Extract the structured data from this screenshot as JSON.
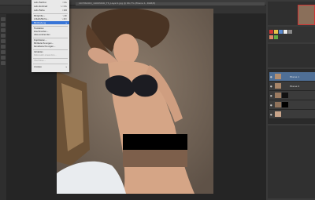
{
  "document": {
    "tab_title": "1070SOOO_14093400_TS_Layer1.jpg @ 66,7% (Ebene 1, RGB/8)"
  },
  "menu": {
    "items": [
      {
        "label": "Auto-Farbton",
        "shortcut": "⇧⌘L"
      },
      {
        "label": "Auto-Kontrast",
        "shortcut": "⌥⇧⌘L"
      },
      {
        "label": "Auto-Farbe",
        "shortcut": "⇧⌘B"
      },
      {
        "label": "Bildgröße...",
        "shortcut": "⌥⌘I"
      },
      {
        "label": "Arbeitsfläche...",
        "shortcut": "⌥⌘C"
      },
      {
        "label": "Bilddrehung",
        "shortcut": ""
      },
      {
        "label": "Freistellen",
        "shortcut": ""
      },
      {
        "label": "Zuschneiden...",
        "shortcut": ""
      },
      {
        "label": "Alles einblenden",
        "shortcut": ""
      },
      {
        "label": "Duplizieren...",
        "shortcut": ""
      },
      {
        "label": "Bildberechnungen...",
        "shortcut": ""
      },
      {
        "label": "Kanalberechnungen...",
        "shortcut": ""
      },
      {
        "label": "Variablen",
        "shortcut": ""
      },
      {
        "label": "Datensatz anwenden...",
        "shortcut": ""
      },
      {
        "label": "Überfüllen...",
        "shortcut": ""
      },
      {
        "label": "Analyse",
        "shortcut": ""
      }
    ],
    "highlighted_index": 5
  },
  "layers": [
    {
      "name": "Ebene 1"
    },
    {
      "name": "Ebene 0"
    },
    {
      "name": ""
    },
    {
      "name": ""
    },
    {
      "name": ""
    }
  ],
  "colors": {
    "menu_highlight": "#3875d7",
    "layer_selected": "#4f6f96"
  }
}
